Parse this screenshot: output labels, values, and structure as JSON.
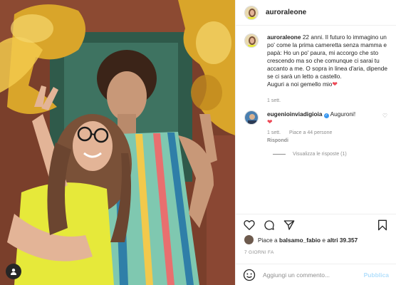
{
  "post": {
    "author": "auroraleone",
    "caption_author": "auroraleone",
    "caption_text": "22 anni. Il futuro lo immagino un po' come la prima cameretta senza mamma e papà: Ho un po' paura, mi accorgo che sto crescendo ma so che comunque ci sarai tu accanto a me. O sopra in linea d'aria, dipende se ci sarà un letto a castello.",
    "caption_line2": "Auguri a noi gemello mio",
    "caption_time": "1 sett."
  },
  "comments": [
    {
      "user": "eugenioinviadigioia",
      "text": "Auguroni!",
      "time": "1 sett.",
      "likes": "Piace a 44 persone",
      "reply_label": "Rispondi",
      "view_replies": "Visualizza le risposte (1)"
    }
  ],
  "likes": {
    "prefix": "Piace a",
    "user": "balsamo_fabio",
    "connector": "e",
    "others": "altri 39.357"
  },
  "date_label": "7 GIORNI FA",
  "comment_box": {
    "placeholder": "Aggiungi un commento...",
    "publish_label": "Pubblica"
  },
  "colors": {
    "heart": "#ed4956",
    "verified": "#3897f0",
    "publish_disabled": "#b2dffc"
  },
  "icons": [
    "heart-icon",
    "comment-icon",
    "share-icon",
    "save-icon",
    "emoji-icon",
    "user-tag-icon",
    "verified-icon"
  ]
}
